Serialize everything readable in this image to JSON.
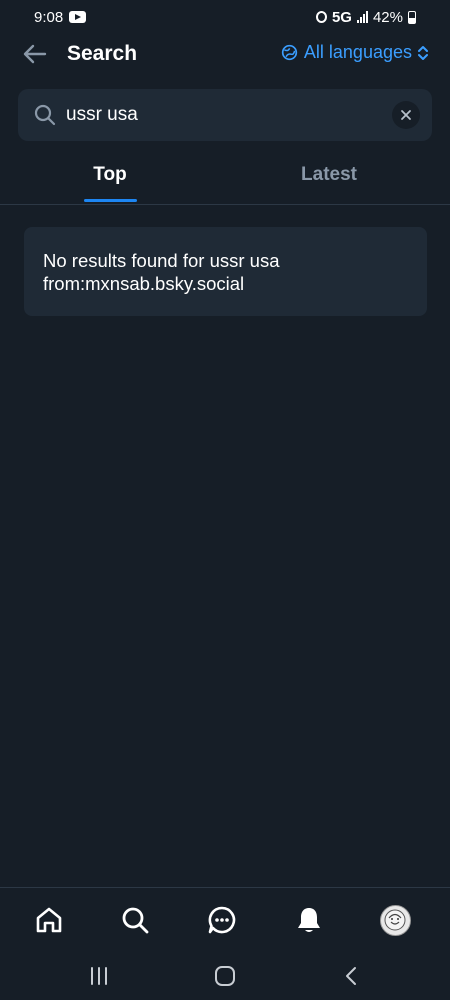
{
  "status_bar": {
    "time": "9:08",
    "network": "5G",
    "battery": "42%",
    "icons": [
      "youtube-icon",
      "alarm-icon",
      "signal-icon",
      "battery-icon"
    ]
  },
  "header": {
    "title": "Search",
    "language_selector": "All languages",
    "back_icon": "arrow-left-icon"
  },
  "search": {
    "value": "ussr usa",
    "placeholder": ""
  },
  "tabs": [
    {
      "label": "Top",
      "active": true
    },
    {
      "label": "Latest",
      "active": false
    }
  ],
  "results": {
    "empty_line1": "No results found for ussr usa",
    "empty_line2": "from:mxnsab.bsky.social"
  },
  "bottom_nav": [
    "home-icon",
    "search-icon",
    "chat-icon",
    "bell-icon",
    "avatar"
  ],
  "system_nav": [
    "recents-icon",
    "home-circle-icon",
    "back-chevron-icon"
  ],
  "colors": {
    "background": "#161e27",
    "surface": "#1f2a36",
    "accent": "#1d86f2",
    "link": "#3b9eff",
    "muted": "#8a98a8"
  }
}
